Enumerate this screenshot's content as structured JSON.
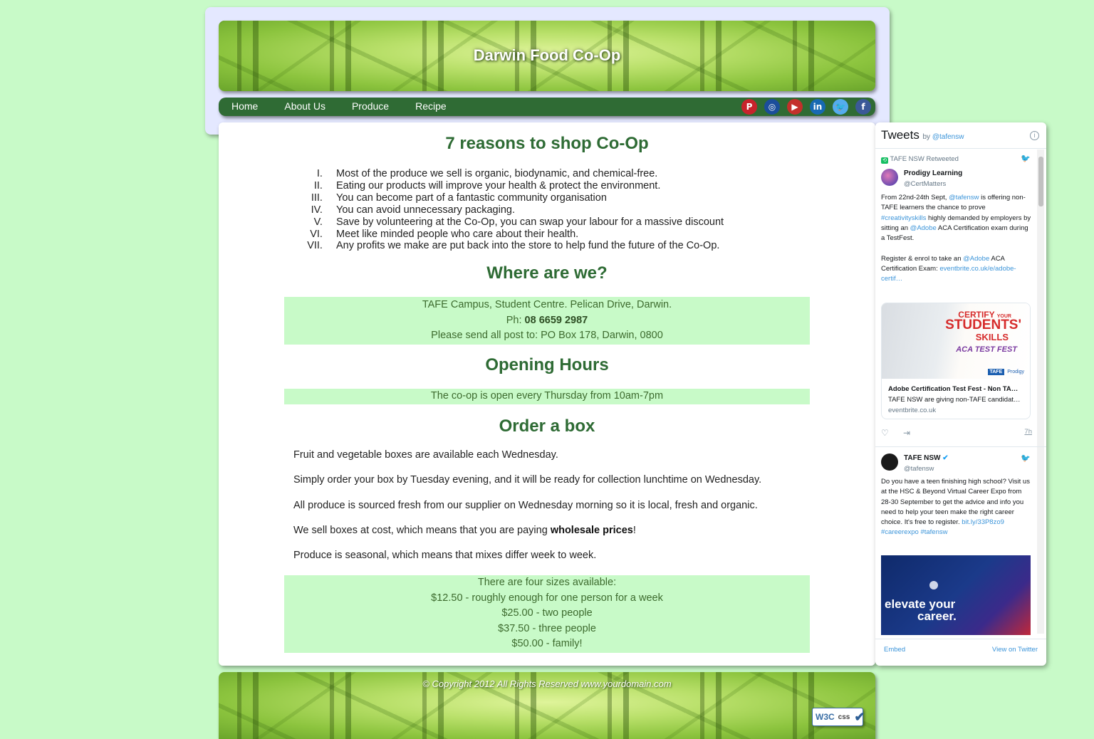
{
  "header": {
    "title": "Darwin Food Co-Op"
  },
  "nav": {
    "links": [
      "Home",
      "About Us",
      "Produce",
      "Recipe"
    ],
    "social": [
      {
        "icon": "pinterest-icon",
        "glyph": "P",
        "color": "#c8232c"
      },
      {
        "icon": "instagram-icon",
        "glyph": "◎",
        "color": "#1b4e9b"
      },
      {
        "icon": "youtube-icon",
        "glyph": "▶",
        "color": "#c4302b"
      },
      {
        "icon": "linkedin-icon",
        "glyph": "in",
        "color": "#1769b3"
      },
      {
        "icon": "twitter-icon",
        "glyph": "🐦",
        "color": "#55acee"
      },
      {
        "icon": "facebook-icon",
        "glyph": "f",
        "color": "#3b5998"
      }
    ]
  },
  "main": {
    "reasons_title": "7 reasons to shop Co-Op",
    "reasons": [
      "Most of the produce we sell is organic, biodynamic, and chemical-free.",
      "Eating our products will improve your health & protect the environment.",
      "You can become part of a fantastic community organisation",
      "You can avoid unnecessary packaging.",
      "Save by volunteering at the Co-Op, you can swap your labour for a massive discount",
      "Meet like minded people who care about their health.",
      "Any profits we make are put back into the store to help fund the future of the Co-Op."
    ],
    "where_title": "Where are we?",
    "address": "TAFE Campus, Student Centre. Pelican Drive, Darwin.",
    "phone_label": "Ph: ",
    "phone": "08 6659 2987",
    "post": "Please send all post to: PO Box 178, Darwin, 0800",
    "hours_title": "Opening Hours",
    "hours": "The co-op is open every Thursday from 10am-7pm",
    "order_title": "Order a box",
    "order_paras": [
      "Fruit and vegetable boxes are available each Wednesday.",
      "Simply order your box by Tuesday evening, and it will be ready for collection lunchtime on Wednesday.",
      "All produce is sourced fresh from our supplier on Wednesday morning so it is local, fresh and organic."
    ],
    "wholesale_prefix": "We sell boxes at cost, which means that you are paying ",
    "wholesale_bold": "wholesale prices",
    "wholesale_suffix": "!",
    "seasonal": "Produce is seasonal, which means that mixes differ week to week.",
    "sizes": [
      "There are four sizes available:",
      "$12.50 - roughly enough for one person for a week",
      "$25.00 - two people",
      "$37.50 - three people",
      "$50.00 - family!"
    ]
  },
  "footer": {
    "copyright": "© Copyright 2012 All Rights Reserved www.yourdomain.com",
    "w3c_label": "W3C",
    "css_label": "css"
  },
  "twitter": {
    "title": "Tweets",
    "by": "by ",
    "handle": "@tafensw",
    "tweet1": {
      "retweeted": "TAFE NSW Retweeted",
      "name": "Prodigy Learning",
      "handle": "@CertMatters",
      "text_a": "From 22nd-24th Sept, ",
      "mention_a": "@tafensw",
      "text_b": " is offering non-TAFE learners the chance to prove ",
      "hashtag": "#creativityskills",
      "text_c": " highly demanded by employers by sitting an ",
      "mention_b": "@Adobe",
      "text_d": " ACA Certification exam during a TestFest.",
      "text_e": "Register & enrol to take an ",
      "mention_c": "@Adobe",
      "text_f": " ACA Certification Exam: ",
      "link": "eventbrite.co.uk/e/adobe-certif…",
      "card_title": "Adobe Certification Test Fest - Non TA…",
      "card_desc": "TAFE NSW are giving non-TAFE candidat…",
      "card_domain": "eventbrite.co.uk",
      "img_certify": "CERTIFY",
      "img_your": "YOUR",
      "img_students": "STUDENTS'",
      "img_skills": "SKILLS",
      "img_testfest": "ACA TEST FEST",
      "img_tafe": "TAFE",
      "img_prodigy": "Prodigy",
      "time": "7h"
    },
    "tweet2": {
      "name": "TAFE NSW",
      "handle": "@tafensw",
      "text": "Do you have a teen finishing high school? Visit us at the HSC & Beyond Virtual Career Expo from 28-30 September to get the advice and info you need to help your teen make the right career choice. It's free to register. ",
      "link": "bit.ly/33P8zo9",
      "hashtags": "#careerexpo #tafensw",
      "promo_line1": "elevate your",
      "promo_line2": "career."
    },
    "embed": "Embed",
    "view": "View on Twitter"
  }
}
